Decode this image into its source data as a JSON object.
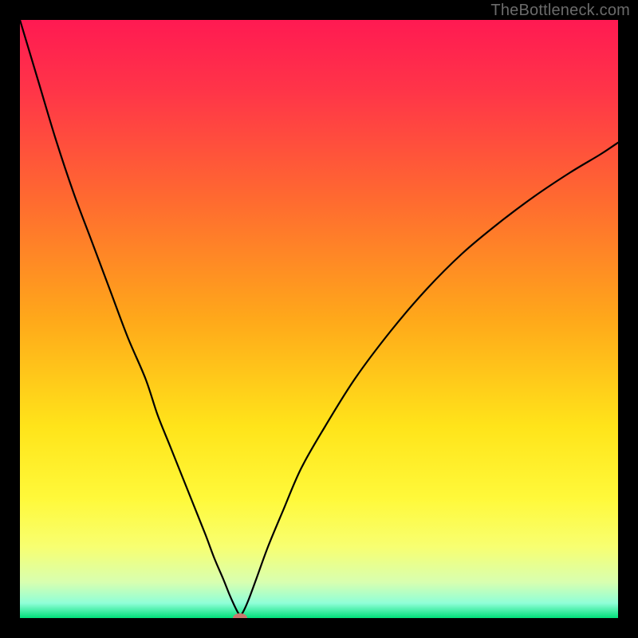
{
  "watermark": "TheBottleneck.com",
  "chart_data": {
    "type": "line",
    "title": "",
    "xlabel": "",
    "ylabel": "",
    "xlim": [
      0,
      100
    ],
    "ylim": [
      0,
      100
    ],
    "grid": false,
    "legend": null,
    "background_gradient": {
      "stops": [
        {
          "offset": 0.0,
          "color": "#ff1a52"
        },
        {
          "offset": 0.12,
          "color": "#ff3548"
        },
        {
          "offset": 0.3,
          "color": "#ff6a30"
        },
        {
          "offset": 0.5,
          "color": "#ffa81a"
        },
        {
          "offset": 0.68,
          "color": "#ffe41a"
        },
        {
          "offset": 0.8,
          "color": "#fff93a"
        },
        {
          "offset": 0.88,
          "color": "#f8ff70"
        },
        {
          "offset": 0.94,
          "color": "#d8ffb0"
        },
        {
          "offset": 0.975,
          "color": "#90ffd8"
        },
        {
          "offset": 1.0,
          "color": "#00e07a"
        }
      ]
    },
    "series": [
      {
        "name": "bottleneck-curve",
        "color": "#000000",
        "x": [
          0,
          3,
          6,
          9,
          12,
          15,
          18,
          21,
          23,
          25,
          27,
          29,
          31,
          32.5,
          34,
          35,
          35.8,
          36.4,
          36.8,
          36.8,
          37.3,
          38.2,
          39.5,
          41.5,
          44,
          47,
          51,
          56,
          62,
          68,
          74,
          80,
          86,
          92,
          97,
          100
        ],
        "y": [
          100,
          90,
          80,
          71,
          63,
          55,
          47,
          40,
          34,
          29,
          24,
          19,
          14,
          10,
          6.5,
          4,
          2.2,
          1.0,
          0.4,
          0.4,
          1.0,
          3.0,
          6.5,
          12,
          18,
          25,
          32,
          40,
          48,
          55,
          61,
          66,
          70.5,
          74.5,
          77.5,
          79.5
        ]
      }
    ],
    "marker": {
      "name": "min-point",
      "x": 36.8,
      "y": 0.0,
      "rx": 1.2,
      "ry": 0.8,
      "color": "#c9786e"
    }
  }
}
